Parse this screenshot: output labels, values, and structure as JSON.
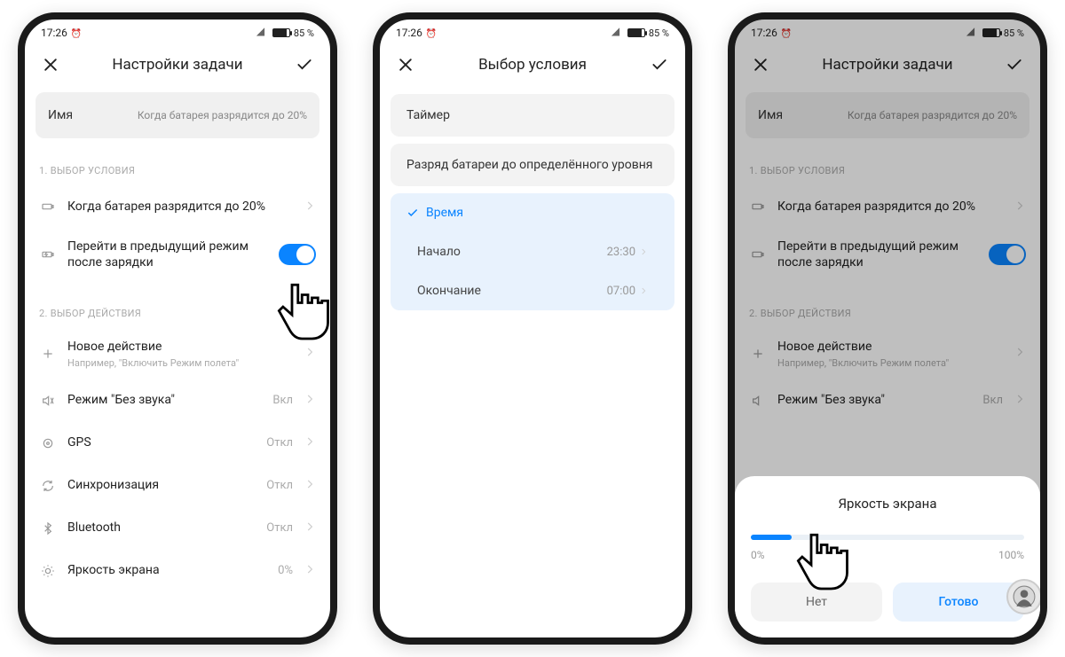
{
  "statusbar": {
    "time": "17:26",
    "battery": "85 %"
  },
  "screen1": {
    "header_title": "Настройки задачи",
    "name_label": "Имя",
    "name_value": "Когда батарея разрядится до 20%",
    "section1": "1. ВЫБОР УСЛОВИЯ",
    "cond_title": "Когда батарея разрядится до 20%",
    "revert_title": "Перейти в предыдущий режим после зарядки",
    "section2": "2. ВЫБОР ДЕЙСТВИЯ",
    "new_action_title": "Новое действие",
    "new_action_sub": "Например, \"Включить Режим полета\"",
    "silent_title": "Режим \"Без звука\"",
    "silent_value": "Вкл",
    "gps_title": "GPS",
    "gps_value": "Откл",
    "sync_title": "Синхронизация",
    "sync_value": "Откл",
    "bt_title": "Bluetooth",
    "bt_value": "Откл",
    "bright_title": "Яркость экрана",
    "bright_value": "0%"
  },
  "screen2": {
    "header_title": "Выбор условия",
    "opt_timer": "Таймер",
    "opt_batt": "Разряд батареи до определённого уровня",
    "opt_time": "Время",
    "start_label": "Начало",
    "start_value": "23:30",
    "end_label": "Окончание",
    "end_value": "07:00"
  },
  "screen3": {
    "sheet_title": "Яркость экрана",
    "min_label": "0%",
    "max_label": "100%",
    "cancel": "Нет",
    "ok": "Готово"
  }
}
